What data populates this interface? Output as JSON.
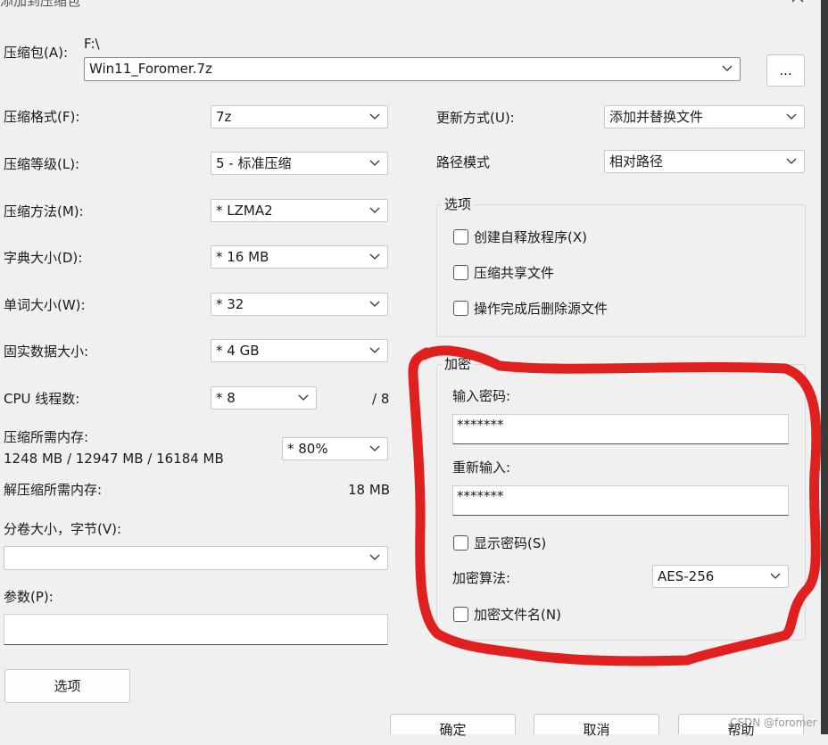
{
  "window": {
    "title": "添加到压缩包"
  },
  "archive": {
    "label": "压缩包(A):",
    "path": "F:\\",
    "name": "Win11_Foromer.7z",
    "browse_label": "..."
  },
  "left": {
    "format": {
      "label": "压缩格式(F):",
      "value": "7z"
    },
    "level": {
      "label": "压缩等级(L):",
      "value": "5 - 标准压缩"
    },
    "method": {
      "label": "压缩方法(M):",
      "value": "*  LZMA2"
    },
    "dict": {
      "label": "字典大小(D):",
      "value": "*  16 MB"
    },
    "word": {
      "label": "单词大小(W):",
      "value": "*  32"
    },
    "solid": {
      "label": "固实数据大小:",
      "value": "*  4 GB"
    },
    "threads": {
      "label": "CPU 线程数:",
      "value": "*  8",
      "max": "/ 8"
    },
    "mem": {
      "label": "压缩所需内存:",
      "detail": "1248 MB / 12947 MB / 16184 MB",
      "value": "* 80%"
    },
    "decomp": {
      "label": "解压缩所需内存:",
      "value": "18 MB"
    },
    "volume": {
      "label": "分卷大小，字节(V):",
      "value": ""
    },
    "params": {
      "label": "参数(P):",
      "value": ""
    },
    "options_button": "选项"
  },
  "right": {
    "update": {
      "label": "更新方式(U):",
      "value": "添加并替换文件"
    },
    "pathmode": {
      "label": "路径模式",
      "value": "相对路径"
    },
    "options": {
      "title": "选项",
      "sfx": "创建自释放程序(X)",
      "shared": "压缩共享文件",
      "delete": "操作完成后删除源文件"
    },
    "encryption": {
      "title": "加密",
      "password_label": "输入密码:",
      "password_value": "*******",
      "repeat_label": "重新输入:",
      "repeat_value": "*******",
      "show_password": "显示密码(S)",
      "method_label": "加密算法:",
      "method_value": "AES-256",
      "encrypt_names": "加密文件名(N)"
    }
  },
  "footer": {
    "ok": "确定",
    "cancel": "取消",
    "help": "帮助"
  },
  "watermark": "CSDN @foromer",
  "colors": {
    "annotation": "#e0201f",
    "background": "#f0f0f0"
  }
}
